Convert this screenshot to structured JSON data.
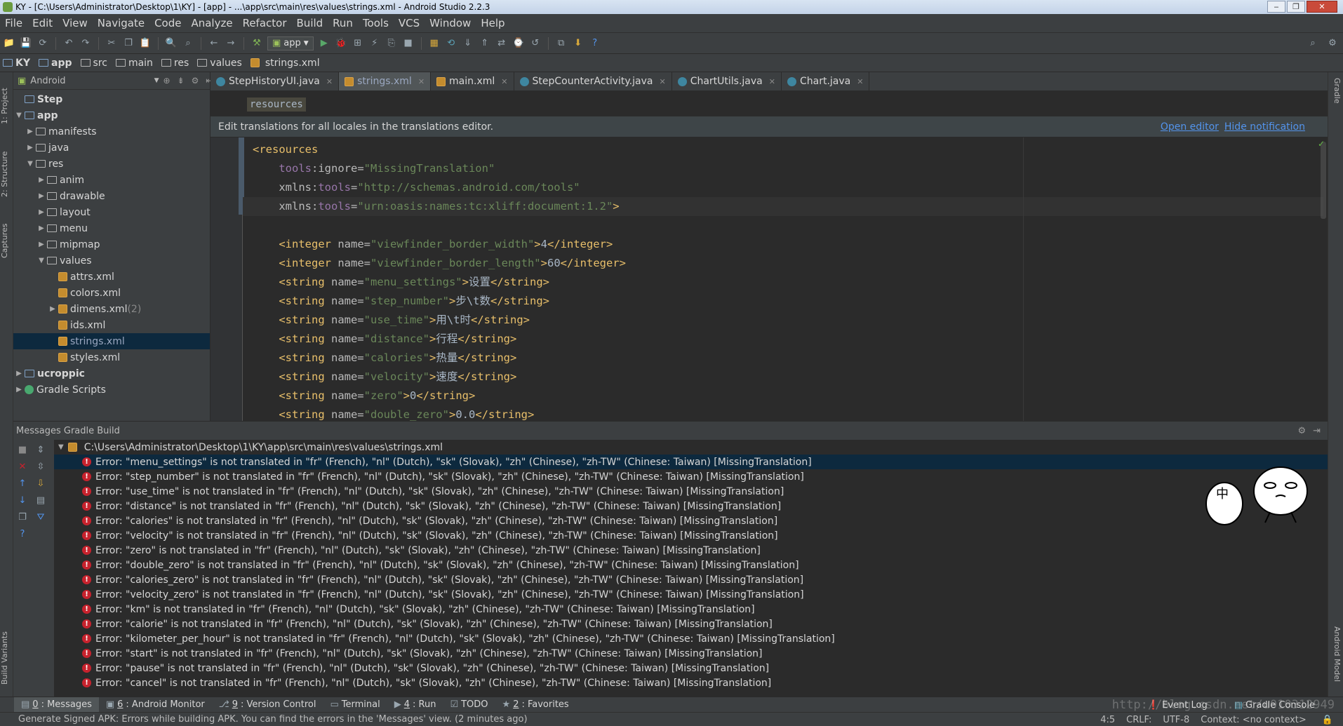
{
  "window": {
    "title": "KY - [C:\\Users\\Administrator\\Desktop\\1\\KY] - [app] - ...\\app\\src\\main\\res\\values\\strings.xml - Android Studio 2.2.3",
    "controls": [
      "‒",
      "❐",
      "✕"
    ]
  },
  "menu": [
    "File",
    "Edit",
    "View",
    "Navigate",
    "Code",
    "Analyze",
    "Refactor",
    "Build",
    "Run",
    "Tools",
    "VCS",
    "Window",
    "Help"
  ],
  "toolbar": {
    "run_config": "app"
  },
  "breadcrumbs": [
    {
      "label": "KY",
      "bold": true
    },
    {
      "label": "app",
      "bold": true
    },
    {
      "label": "src"
    },
    {
      "label": "main"
    },
    {
      "label": "res"
    },
    {
      "label": "values"
    },
    {
      "label": "strings.xml"
    }
  ],
  "left_strip": [
    "1: Project",
    "2: Structure",
    "Captures",
    "Build Variants"
  ],
  "right_strip": [
    "Gradle",
    "Android Model"
  ],
  "project_panel": {
    "view": "Android",
    "tree": [
      {
        "label": "Step",
        "depth": 0,
        "arrow": "",
        "icon": "folder",
        "bold": true
      },
      {
        "label": "app",
        "depth": 0,
        "arrow": "▼",
        "icon": "folder",
        "bold": true
      },
      {
        "label": "manifests",
        "depth": 1,
        "arrow": "▶",
        "icon": "folder"
      },
      {
        "label": "java",
        "depth": 1,
        "arrow": "▶",
        "icon": "folder"
      },
      {
        "label": "res",
        "depth": 1,
        "arrow": "▼",
        "icon": "folder"
      },
      {
        "label": "anim",
        "depth": 2,
        "arrow": "▶",
        "icon": "folder"
      },
      {
        "label": "drawable",
        "depth": 2,
        "arrow": "▶",
        "icon": "folder"
      },
      {
        "label": "layout",
        "depth": 2,
        "arrow": "▶",
        "icon": "folder"
      },
      {
        "label": "menu",
        "depth": 2,
        "arrow": "▶",
        "icon": "folder"
      },
      {
        "label": "mipmap",
        "depth": 2,
        "arrow": "▶",
        "icon": "folder"
      },
      {
        "label": "values",
        "depth": 2,
        "arrow": "▼",
        "icon": "folder"
      },
      {
        "label": "attrs.xml",
        "depth": 3,
        "arrow": "",
        "icon": "xml"
      },
      {
        "label": "colors.xml",
        "depth": 3,
        "arrow": "",
        "icon": "xml"
      },
      {
        "label": "dimens.xml",
        "suffix": " (2)",
        "depth": 3,
        "arrow": "▶",
        "icon": "xml"
      },
      {
        "label": "ids.xml",
        "depth": 3,
        "arrow": "",
        "icon": "xml"
      },
      {
        "label": "strings.xml",
        "depth": 3,
        "arrow": "",
        "icon": "xml",
        "selected": true
      },
      {
        "label": "styles.xml",
        "depth": 3,
        "arrow": "",
        "icon": "xml"
      },
      {
        "label": "ucroppic",
        "depth": 0,
        "arrow": "▶",
        "icon": "folder",
        "bold": true
      },
      {
        "label": "Gradle Scripts",
        "depth": 0,
        "arrow": "▶",
        "icon": "gradle"
      }
    ]
  },
  "editor_tabs": [
    {
      "label": "StepHistoryUI.java",
      "icon": "java"
    },
    {
      "label": "strings.xml",
      "icon": "xml",
      "active": true
    },
    {
      "label": "main.xml",
      "icon": "xml"
    },
    {
      "label": "StepCounterActivity.java",
      "icon": "java"
    },
    {
      "label": "ChartUtils.java",
      "icon": "java"
    },
    {
      "label": "Chart.java",
      "icon": "java"
    }
  ],
  "editor": {
    "breadcrumb": "resources",
    "notification": {
      "text": "Edit translations for all locales in the translations editor.",
      "open_editor": "Open editor",
      "hide_notification": "Hide notification"
    },
    "lines": [
      [
        {
          "c": "t",
          "v": "<resources"
        }
      ],
      [
        {
          "c": "txt",
          "v": "    "
        },
        {
          "c": "ns",
          "v": "tools"
        },
        {
          "c": "a",
          "v": ":ignore="
        },
        {
          "c": "s",
          "v": "\"MissingTranslation\""
        }
      ],
      [
        {
          "c": "txt",
          "v": "    "
        },
        {
          "c": "a",
          "v": "xmlns:"
        },
        {
          "c": "ns",
          "v": "tools"
        },
        {
          "c": "a",
          "v": "="
        },
        {
          "c": "s",
          "v": "\"http://schemas.android.com/tools\""
        }
      ],
      [
        {
          "c": "txt",
          "v": "    "
        },
        {
          "c": "a",
          "v": "xmlns:"
        },
        {
          "c": "ns",
          "v": "tools"
        },
        {
          "c": "a",
          "v": "="
        },
        {
          "c": "s",
          "v": "\"urn:oasis:names:tc:xliff:document:1.2\""
        },
        {
          "c": "t",
          "v": ">"
        }
      ],
      [
        {
          "c": "txt",
          "v": ""
        }
      ],
      [
        {
          "c": "txt",
          "v": "    "
        },
        {
          "c": "t",
          "v": "<integer "
        },
        {
          "c": "a",
          "v": "name="
        },
        {
          "c": "s",
          "v": "\"viewfinder_border_width\""
        },
        {
          "c": "t",
          "v": ">"
        },
        {
          "c": "txt",
          "v": "4"
        },
        {
          "c": "t",
          "v": "</integer>"
        }
      ],
      [
        {
          "c": "txt",
          "v": "    "
        },
        {
          "c": "t",
          "v": "<integer "
        },
        {
          "c": "a",
          "v": "name="
        },
        {
          "c": "s",
          "v": "\"viewfinder_border_length\""
        },
        {
          "c": "t",
          "v": ">"
        },
        {
          "c": "txt",
          "v": "60"
        },
        {
          "c": "t",
          "v": "</integer>"
        }
      ],
      [
        {
          "c": "txt",
          "v": "    "
        },
        {
          "c": "t",
          "v": "<string "
        },
        {
          "c": "a",
          "v": "name="
        },
        {
          "c": "s",
          "v": "\"menu_settings\""
        },
        {
          "c": "t",
          "v": ">"
        },
        {
          "c": "txt",
          "v": "设置"
        },
        {
          "c": "t",
          "v": "</string>"
        }
      ],
      [
        {
          "c": "txt",
          "v": "    "
        },
        {
          "c": "t",
          "v": "<string "
        },
        {
          "c": "a",
          "v": "name="
        },
        {
          "c": "s",
          "v": "\"step_number\""
        },
        {
          "c": "t",
          "v": ">"
        },
        {
          "c": "txt",
          "v": "步\\t数"
        },
        {
          "c": "t",
          "v": "</string>"
        }
      ],
      [
        {
          "c": "txt",
          "v": "    "
        },
        {
          "c": "t",
          "v": "<string "
        },
        {
          "c": "a",
          "v": "name="
        },
        {
          "c": "s",
          "v": "\"use_time\""
        },
        {
          "c": "t",
          "v": ">"
        },
        {
          "c": "txt",
          "v": "用\\t时"
        },
        {
          "c": "t",
          "v": "</string>"
        }
      ],
      [
        {
          "c": "txt",
          "v": "    "
        },
        {
          "c": "t",
          "v": "<string "
        },
        {
          "c": "a",
          "v": "name="
        },
        {
          "c": "s",
          "v": "\"distance\""
        },
        {
          "c": "t",
          "v": ">"
        },
        {
          "c": "txt",
          "v": "行程"
        },
        {
          "c": "t",
          "v": "</string>"
        }
      ],
      [
        {
          "c": "txt",
          "v": "    "
        },
        {
          "c": "t",
          "v": "<string "
        },
        {
          "c": "a",
          "v": "name="
        },
        {
          "c": "s",
          "v": "\"calories\""
        },
        {
          "c": "t",
          "v": ">"
        },
        {
          "c": "txt",
          "v": "热量"
        },
        {
          "c": "t",
          "v": "</string>"
        }
      ],
      [
        {
          "c": "txt",
          "v": "    "
        },
        {
          "c": "t",
          "v": "<string "
        },
        {
          "c": "a",
          "v": "name="
        },
        {
          "c": "s",
          "v": "\"velocity\""
        },
        {
          "c": "t",
          "v": ">"
        },
        {
          "c": "txt",
          "v": "速度"
        },
        {
          "c": "t",
          "v": "</string>"
        }
      ],
      [
        {
          "c": "txt",
          "v": "    "
        },
        {
          "c": "t",
          "v": "<string "
        },
        {
          "c": "a",
          "v": "name="
        },
        {
          "c": "s",
          "v": "\"zero\""
        },
        {
          "c": "t",
          "v": ">"
        },
        {
          "c": "txt",
          "v": "0"
        },
        {
          "c": "t",
          "v": "</string>"
        }
      ],
      [
        {
          "c": "txt",
          "v": "    "
        },
        {
          "c": "t",
          "v": "<string "
        },
        {
          "c": "a",
          "v": "name="
        },
        {
          "c": "s",
          "v": "\"double_zero\""
        },
        {
          "c": "t",
          "v": ">"
        },
        {
          "c": "txt",
          "v": "0.0"
        },
        {
          "c": "t",
          "v": "</string>"
        }
      ]
    ]
  },
  "messages": {
    "title": "Messages Gradle Build",
    "file_path": "C:\\Users\\Administrator\\Desktop\\1\\KY\\app\\src\\main\\res\\values\\strings.xml",
    "errors": [
      "Error: \"menu_settings\" is not translated in \"fr\" (French), \"nl\" (Dutch), \"sk\" (Slovak), \"zh\" (Chinese), \"zh-TW\" (Chinese: Taiwan) [MissingTranslation]",
      "Error: \"step_number\" is not translated in \"fr\" (French), \"nl\" (Dutch), \"sk\" (Slovak), \"zh\" (Chinese), \"zh-TW\" (Chinese: Taiwan) [MissingTranslation]",
      "Error: \"use_time\" is not translated in \"fr\" (French), \"nl\" (Dutch), \"sk\" (Slovak), \"zh\" (Chinese), \"zh-TW\" (Chinese: Taiwan) [MissingTranslation]",
      "Error: \"distance\" is not translated in \"fr\" (French), \"nl\" (Dutch), \"sk\" (Slovak), \"zh\" (Chinese), \"zh-TW\" (Chinese: Taiwan) [MissingTranslation]",
      "Error: \"calories\" is not translated in \"fr\" (French), \"nl\" (Dutch), \"sk\" (Slovak), \"zh\" (Chinese), \"zh-TW\" (Chinese: Taiwan) [MissingTranslation]",
      "Error: \"velocity\" is not translated in \"fr\" (French), \"nl\" (Dutch), \"sk\" (Slovak), \"zh\" (Chinese), \"zh-TW\" (Chinese: Taiwan) [MissingTranslation]",
      "Error: \"zero\" is not translated in \"fr\" (French), \"nl\" (Dutch), \"sk\" (Slovak), \"zh\" (Chinese), \"zh-TW\" (Chinese: Taiwan) [MissingTranslation]",
      "Error: \"double_zero\" is not translated in \"fr\" (French), \"nl\" (Dutch), \"sk\" (Slovak), \"zh\" (Chinese), \"zh-TW\" (Chinese: Taiwan) [MissingTranslation]",
      "Error: \"calories_zero\" is not translated in \"fr\" (French), \"nl\" (Dutch), \"sk\" (Slovak), \"zh\" (Chinese), \"zh-TW\" (Chinese: Taiwan) [MissingTranslation]",
      "Error: \"velocity_zero\" is not translated in \"fr\" (French), \"nl\" (Dutch), \"sk\" (Slovak), \"zh\" (Chinese), \"zh-TW\" (Chinese: Taiwan) [MissingTranslation]",
      "Error: \"km\" is not translated in \"fr\" (French), \"nl\" (Dutch), \"sk\" (Slovak), \"zh\" (Chinese), \"zh-TW\" (Chinese: Taiwan) [MissingTranslation]",
      "Error: \"calorie\" is not translated in \"fr\" (French), \"nl\" (Dutch), \"sk\" (Slovak), \"zh\" (Chinese), \"zh-TW\" (Chinese: Taiwan) [MissingTranslation]",
      "Error: \"kilometer_per_hour\" is not translated in \"fr\" (French), \"nl\" (Dutch), \"sk\" (Slovak), \"zh\" (Chinese), \"zh-TW\" (Chinese: Taiwan) [MissingTranslation]",
      "Error: \"start\" is not translated in \"fr\" (French), \"nl\" (Dutch), \"sk\" (Slovak), \"zh\" (Chinese), \"zh-TW\" (Chinese: Taiwan) [MissingTranslation]",
      "Error: \"pause\" is not translated in \"fr\" (French), \"nl\" (Dutch), \"sk\" (Slovak), \"zh\" (Chinese), \"zh-TW\" (Chinese: Taiwan) [MissingTranslation]",
      "Error: \"cancel\" is not translated in \"fr\" (French), \"nl\" (Dutch), \"sk\" (Slovak), \"zh\" (Chinese), \"zh-TW\" (Chinese: Taiwan) [MissingTranslation]"
    ]
  },
  "bottom_tabs": [
    {
      "key": "0",
      "label": ": Messages",
      "icon": "messages-icon",
      "active": true
    },
    {
      "key": "6",
      "label": ": Android Monitor",
      "icon": "android-icon"
    },
    {
      "key": "9",
      "label": ": Version Control",
      "icon": "vcs-icon"
    },
    {
      "key": "",
      "label": "Terminal",
      "icon": "terminal-icon"
    },
    {
      "key": "4",
      "label": ": Run",
      "icon": "run-icon"
    },
    {
      "key": "",
      "label": "TODO",
      "icon": "todo-icon"
    },
    {
      "key": "2",
      "label": ": Favorites",
      "icon": "star-icon"
    }
  ],
  "bottom_right_tabs": [
    "Event Log",
    "Gradle Console"
  ],
  "status": {
    "message": "Generate Signed APK: Errors while building APK. You can find the errors in the 'Messages' view. (2 minutes ago)",
    "position": "4:5",
    "line_sep": "CRLF:",
    "encoding": "UTF-8",
    "context": "Context: <no context>"
  },
  "watermark": "http://blog.csdn.net/u010312949",
  "sticker_text": "中",
  "colors": {
    "tag": "#e8bf6a",
    "string": "#6a8759",
    "namespace": "#9876aa",
    "selection": "#0d293e",
    "error": "#c7222d",
    "link": "#5394ec"
  }
}
